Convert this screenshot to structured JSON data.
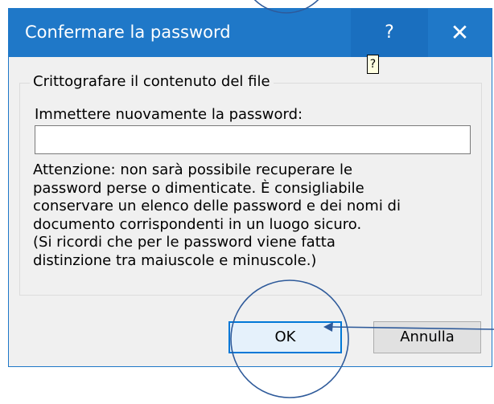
{
  "dialog": {
    "title": "Confermare la password",
    "help_glyph": "?",
    "close_glyph": "✕",
    "tooltip": "?"
  },
  "group": {
    "label": "Crittografare il contenuto del file",
    "prompt": "Immettere nuovamente la password:",
    "password_value": "",
    "warning_lines": [
      "Attenzione: non sarà possibile recuperare le",
      "password perse o dimenticate. È consigliabile",
      "conservare un elenco delle password e dei nomi di",
      "documento corrispondenti in un luogo sicuro.",
      "(Si ricordi che per le password viene fatta",
      "distinzione tra maiuscole e minuscole.)"
    ]
  },
  "buttons": {
    "ok_label": "OK",
    "cancel_label": "Annulla"
  },
  "annotation": {
    "color": "#2e5a9a"
  },
  "colors": {
    "titlebar": "#1f78c8",
    "accent": "#0078d7"
  }
}
